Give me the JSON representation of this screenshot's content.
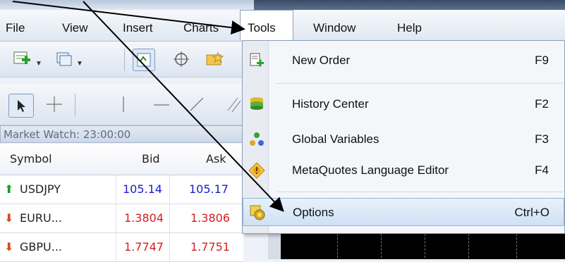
{
  "menubar": {
    "items": [
      "File",
      "View",
      "Insert",
      "Charts",
      "Tools",
      "Window",
      "Help"
    ]
  },
  "market_watch": {
    "title": "Market Watch: 23:00:00",
    "columns": [
      "Symbol",
      "Bid",
      "Ask"
    ],
    "rows": [
      {
        "symbol": "USDJPY",
        "bid": "105.14",
        "ask": "105.17",
        "direction": "up"
      },
      {
        "symbol": "EURU...",
        "bid": "1.3804",
        "ask": "1.3806",
        "direction": "down"
      },
      {
        "symbol": "GBPU...",
        "bid": "1.7747",
        "ask": "1.7751",
        "direction": "down"
      }
    ],
    "colors": {
      "up_text": "#1a1acc",
      "down_text": "#d42020",
      "up_arrow": "#1d9a2c",
      "down_arrow": "#d9481c"
    }
  },
  "tools_menu": {
    "items": [
      {
        "label": "New Order",
        "shortcut": "F9",
        "icon": "new-order-icon"
      },
      {
        "label": "History Center",
        "shortcut": "F2",
        "icon": "history-center-icon"
      },
      {
        "label": "Global Variables",
        "shortcut": "F3",
        "icon": "global-variables-icon"
      },
      {
        "label": "MetaQuotes Language Editor",
        "shortcut": "F4",
        "icon": "metaeditor-icon"
      },
      {
        "label": "Options",
        "shortcut": "Ctrl+O",
        "icon": "options-icon",
        "highlighted": true
      }
    ]
  },
  "toolbar_icons": [
    "new-chart-icon",
    "profiles-icon",
    "market-watch-icon",
    "navigator-icon",
    "favorites-icon",
    "cursor-icon",
    "crosshair-icon",
    "vertical-line-icon",
    "horizontal-line-icon",
    "trendline-icon"
  ]
}
